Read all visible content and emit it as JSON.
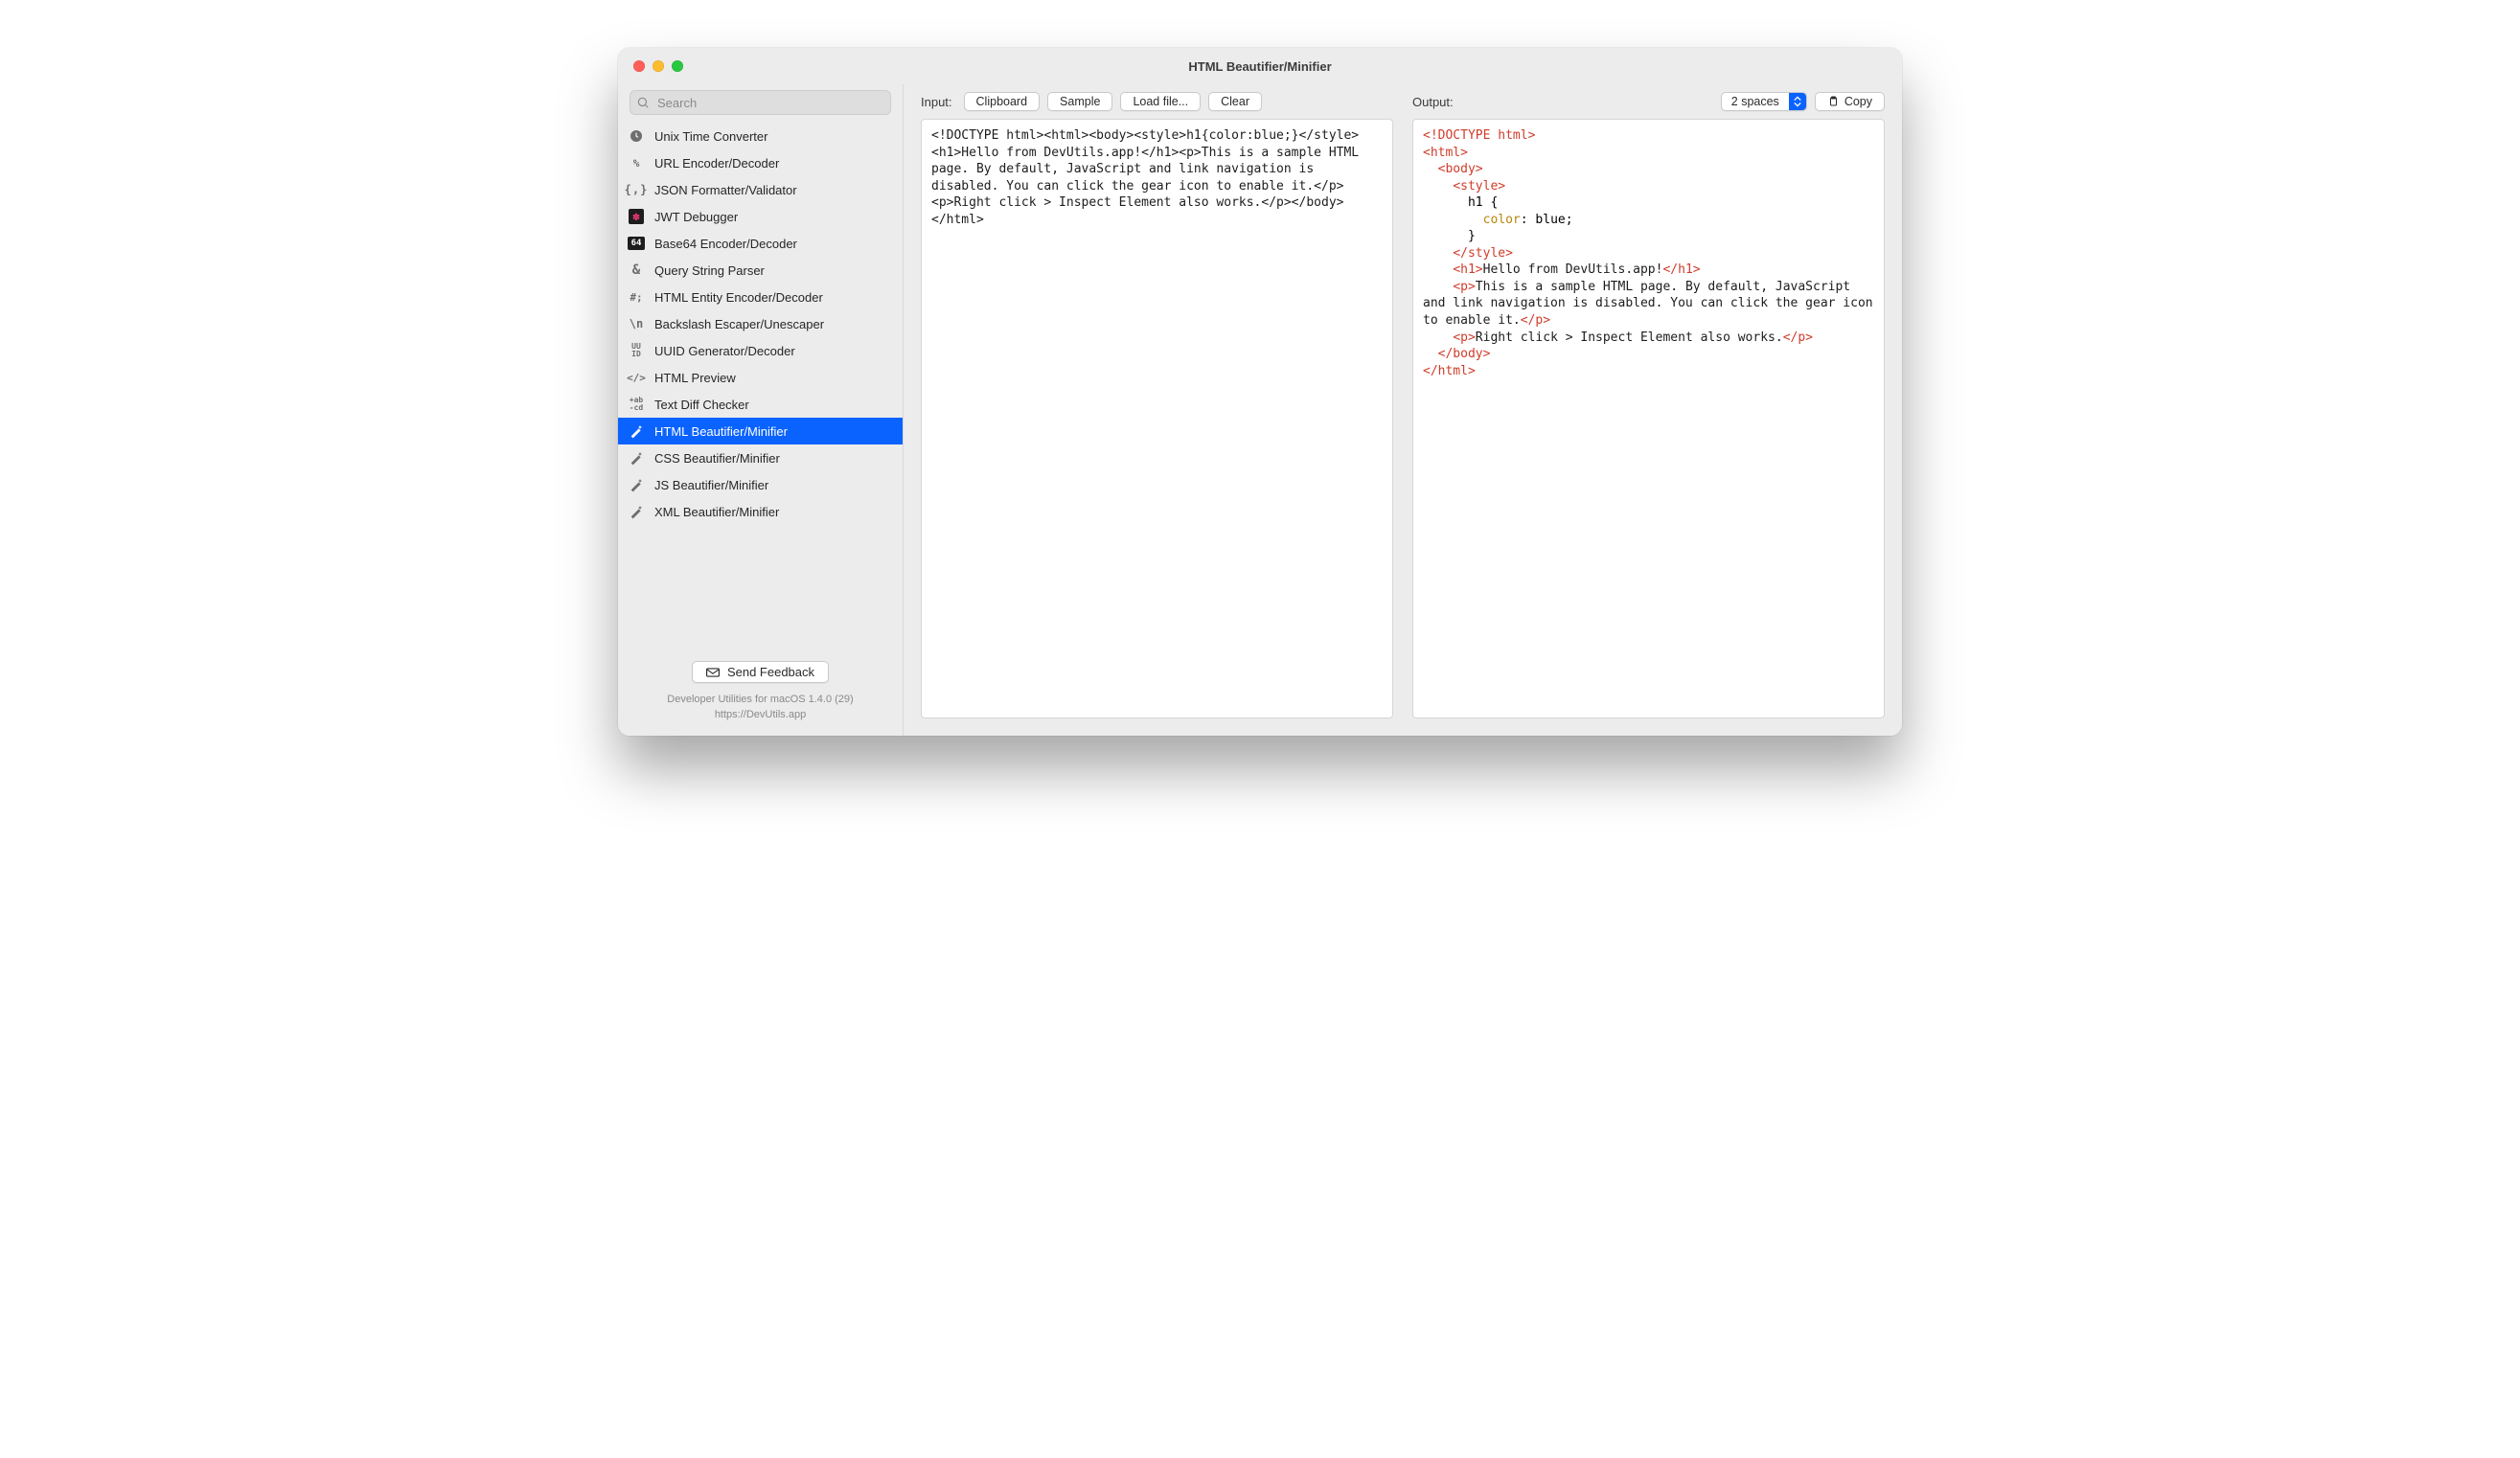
{
  "window": {
    "title": "HTML Beautifier/Minifier"
  },
  "search": {
    "placeholder": "Search"
  },
  "tools": {
    "items": [
      {
        "icon": "clock",
        "label": "Unix Time Converter",
        "active": false
      },
      {
        "icon": "percent",
        "label": "URL Encoder/Decoder",
        "active": false
      },
      {
        "icon": "braces",
        "label": "JSON Formatter/Validator",
        "active": false
      },
      {
        "icon": "jwt",
        "label": "JWT Debugger",
        "active": false
      },
      {
        "icon": "b64",
        "label": "Base64 Encoder/Decoder",
        "active": false
      },
      {
        "icon": "amp",
        "label": "Query String Parser",
        "active": false
      },
      {
        "icon": "hash",
        "label": "HTML Entity Encoder/Decoder",
        "active": false
      },
      {
        "icon": "bslash",
        "label": "Backslash Escaper/Unescaper",
        "active": false
      },
      {
        "icon": "uuid",
        "label": "UUID Generator/Decoder",
        "active": false
      },
      {
        "icon": "code",
        "label": "HTML Preview",
        "active": false
      },
      {
        "icon": "diff",
        "label": "Text Diff Checker",
        "active": false
      },
      {
        "icon": "wand",
        "label": "HTML Beautifier/Minifier",
        "active": true
      },
      {
        "icon": "wand-out",
        "label": "CSS Beautifier/Minifier",
        "active": false
      },
      {
        "icon": "wand-out",
        "label": "JS Beautifier/Minifier",
        "active": false
      },
      {
        "icon": "wand-out",
        "label": "XML Beautifier/Minifier",
        "active": false
      }
    ]
  },
  "feedback": {
    "label": "Send Feedback"
  },
  "meta": {
    "line1": "Developer Utilities for macOS 1.4.0 (29)",
    "line2": "https://DevUtils.app"
  },
  "input": {
    "label": "Input:",
    "buttons": {
      "clipboard": "Clipboard",
      "sample": "Sample",
      "load": "Load file...",
      "clear": "Clear"
    },
    "content": "<!DOCTYPE html><html><body><style>h1{color:blue;}</style><h1>Hello from DevUtils.app!</h1><p>This is a sample HTML page. By default, JavaScript and link navigation is disabled. You can click the gear icon to enable it.</p><p>Right click > Inspect Element also works.</p></body></html>"
  },
  "output": {
    "label": "Output:",
    "indent_option": "2 spaces",
    "copy_label": "Copy",
    "tokens": [
      {
        "c": "t",
        "v": "<!DOCTYPE html>"
      },
      {
        "c": "nl"
      },
      {
        "c": "t",
        "v": "<html>"
      },
      {
        "c": "nl"
      },
      {
        "c": "in",
        "n": 1
      },
      {
        "c": "t",
        "v": "<body>"
      },
      {
        "c": "nl"
      },
      {
        "c": "in",
        "n": 2
      },
      {
        "c": "t",
        "v": "<style>"
      },
      {
        "c": "nl"
      },
      {
        "c": "in",
        "n": 3
      },
      {
        "c": "k",
        "v": "h1 {"
      },
      {
        "c": "nl"
      },
      {
        "c": "in",
        "n": 4
      },
      {
        "c": "prop",
        "v": "color"
      },
      {
        "c": "k",
        "v": ": blue;"
      },
      {
        "c": "nl"
      },
      {
        "c": "in",
        "n": 3
      },
      {
        "c": "k",
        "v": "}"
      },
      {
        "c": "nl"
      },
      {
        "c": "in",
        "n": 2
      },
      {
        "c": "t",
        "v": "</style>"
      },
      {
        "c": "nl"
      },
      {
        "c": "in",
        "n": 2
      },
      {
        "c": "t",
        "v": "<h1>"
      },
      {
        "c": "txt",
        "v": "Hello from DevUtils.app!"
      },
      {
        "c": "t",
        "v": "</h1>"
      },
      {
        "c": "nl"
      },
      {
        "c": "in",
        "n": 2
      },
      {
        "c": "t",
        "v": "<p>"
      },
      {
        "c": "txt",
        "v": "This is a sample HTML page. By default, JavaScript and link navigation is disabled. You can click the gear icon to enable it."
      },
      {
        "c": "t",
        "v": "</p>"
      },
      {
        "c": "nl"
      },
      {
        "c": "in",
        "n": 2
      },
      {
        "c": "t",
        "v": "<p>"
      },
      {
        "c": "txt",
        "v": "Right click > Inspect Element also works."
      },
      {
        "c": "t",
        "v": "</p>"
      },
      {
        "c": "nl"
      },
      {
        "c": "in",
        "n": 1
      },
      {
        "c": "t",
        "v": "</body>"
      },
      {
        "c": "nl"
      },
      {
        "c": "t",
        "v": "</html>"
      }
    ]
  }
}
